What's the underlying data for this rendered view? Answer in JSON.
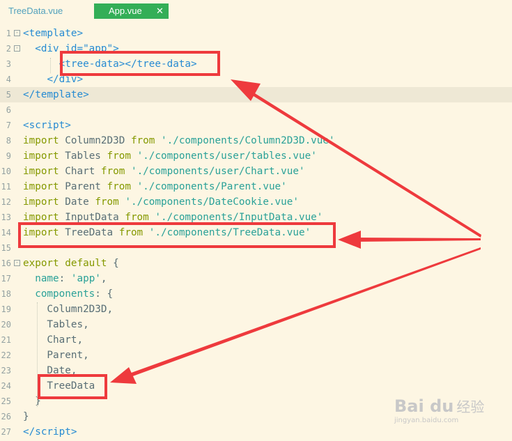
{
  "tabs": [
    {
      "label": "TreeData.vue",
      "active": false
    },
    {
      "label": "App.vue",
      "active": true,
      "close": "✕"
    }
  ],
  "colors": {
    "background": "#FDF6E3",
    "active_tab": "#33AE57",
    "annotation": "#EE3A3D"
  },
  "lines": [
    {
      "num": "1",
      "fold": "-",
      "html": "<span class='tag'>&lt;template&gt;</span>"
    },
    {
      "num": "2",
      "fold": "-",
      "html": "  <span class='tag'>&lt;div id=\"app\"&gt;</span>"
    },
    {
      "num": "3",
      "html": "      <span class='tag'>&lt;tree-data&gt;&lt;/tree-data&gt;</span>"
    },
    {
      "num": "4",
      "html": "    <span class='tag'>&lt;/div&gt;</span>"
    },
    {
      "num": "5",
      "html": "<span class='tag'>&lt;/template&gt;</span>",
      "highlight": true
    },
    {
      "num": "6",
      "html": ""
    },
    {
      "num": "7",
      "html": "<span class='tag'>&lt;script&gt;</span>"
    },
    {
      "num": "8",
      "html": "<span class='kw'>import</span> Column2D3D <span class='kw'>from</span> <span class='str'>'./components/Column2D3D.vue'</span>"
    },
    {
      "num": "9",
      "html": "<span class='kw'>import</span> Tables <span class='kw'>from</span> <span class='str'>'./components/user/tables.vue'</span>"
    },
    {
      "num": "10",
      "html": "<span class='kw'>import</span> Chart <span class='kw'>from</span> <span class='str'>'./components/user/Chart.vue'</span>"
    },
    {
      "num": "11",
      "html": "<span class='kw'>import</span> Parent <span class='kw'>from</span> <span class='str'>'./components/Parent.vue'</span>"
    },
    {
      "num": "12",
      "html": "<span class='kw'>import</span> Date <span class='kw'>from</span> <span class='str'>'./components/DateCookie.vue'</span>"
    },
    {
      "num": "13",
      "html": "<span class='kw'>import</span> InputData <span class='kw'>from</span> <span class='str'>'./components/InputData.vue'</span>"
    },
    {
      "num": "14",
      "html": "<span class='kw'>import</span> TreeData <span class='kw'>from</span> <span class='str'>'./components/TreeData.vue'</span>"
    },
    {
      "num": "15",
      "html": ""
    },
    {
      "num": "16",
      "fold": "-",
      "html": "<span class='kw'>export default</span> {"
    },
    {
      "num": "17",
      "html": "  <span class='prop'>name</span>: <span class='str'>'app'</span>,"
    },
    {
      "num": "18",
      "html": "  <span class='prop'>components</span>: {"
    },
    {
      "num": "19",
      "html": "    Column2D3D,"
    },
    {
      "num": "20",
      "html": "    Tables,"
    },
    {
      "num": "21",
      "html": "    Chart,"
    },
    {
      "num": "22",
      "html": "    Parent,"
    },
    {
      "num": "23",
      "html": "    Date,"
    },
    {
      "num": "24",
      "html": "    TreeData"
    },
    {
      "num": "25",
      "html": "  }"
    },
    {
      "num": "26",
      "html": "}"
    },
    {
      "num": "27",
      "html": "<span class='tag'>&lt;/script&gt;</span>"
    }
  ],
  "watermark": {
    "brand": "Bai du",
    "cn": "经验",
    "url": "jingyan.baidu.com"
  }
}
